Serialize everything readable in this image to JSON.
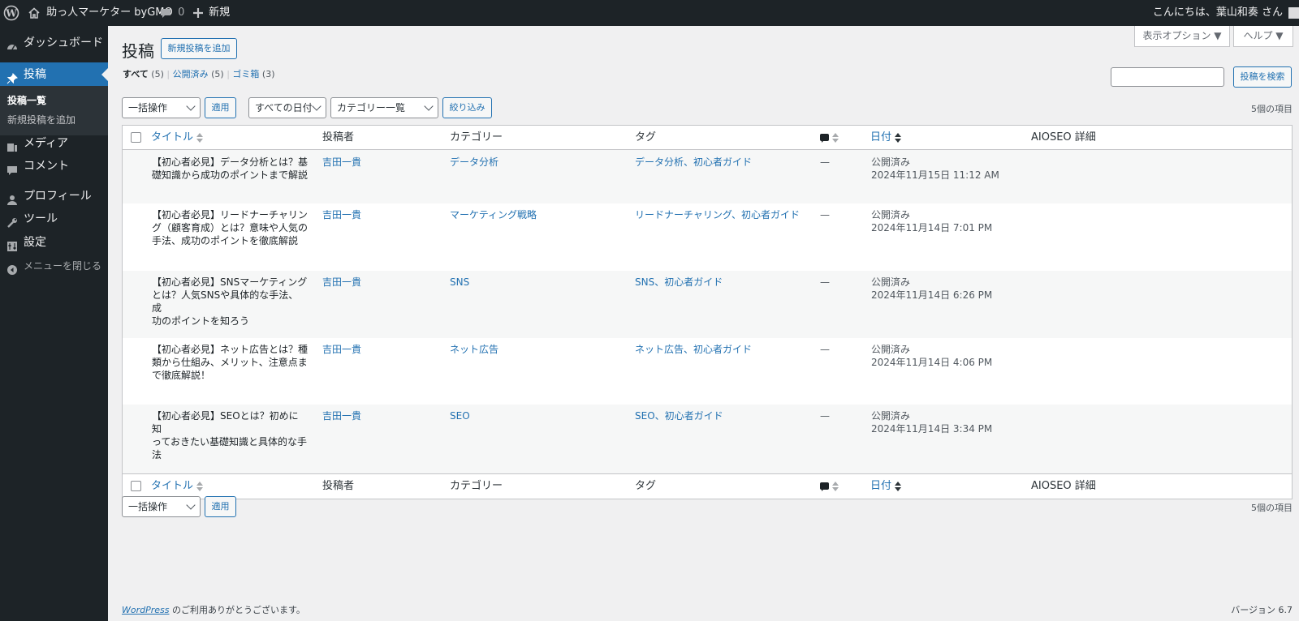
{
  "topbar": {
    "site_name": "助っ人マーケター byGMO",
    "comments_count": "0",
    "new_label": "新規",
    "greeting": "こんにちは、葉山和奏 さん"
  },
  "sidebar": {
    "items": [
      {
        "label": "ダッシュボード",
        "icon": "dashboard-icon"
      },
      {
        "label": "投稿",
        "icon": "pin-icon"
      },
      {
        "label": "メディア",
        "icon": "media-icon"
      },
      {
        "label": "コメント",
        "icon": "comment-icon"
      },
      {
        "label": "プロフィール",
        "icon": "user-icon"
      },
      {
        "label": "ツール",
        "icon": "wrench-icon"
      },
      {
        "label": "設定",
        "icon": "settings-icon"
      },
      {
        "label": "メニューを閉じる",
        "icon": "collapse-icon"
      }
    ],
    "submenu": [
      {
        "label": "投稿一覧"
      },
      {
        "label": "新規投稿を追加"
      }
    ]
  },
  "page": {
    "title": "投稿",
    "add_new": "新規投稿を追加",
    "screen_options": "表示オプション ▼",
    "help": "ヘルプ ▼",
    "filters": {
      "all": "すべて",
      "all_count": "(5)",
      "published": "公開済み",
      "published_count": "(5)",
      "trash": "ゴミ箱",
      "trash_count": "(3)"
    },
    "search_placeholder": "",
    "search_button": "投稿を検索",
    "bulk_action": "一括操作",
    "apply": "適用",
    "date_filter": "すべての日付",
    "category_filter": "カテゴリー一覧",
    "filter_button": "絞り込み",
    "items_count": "5個の項目"
  },
  "table": {
    "columns": {
      "title": "タイトル",
      "author": "投稿者",
      "category": "カテゴリー",
      "tags": "タグ",
      "date": "日付",
      "aioseo": "AIOSEO 詳細"
    },
    "rows": [
      {
        "title_lines": [
          "【初心者必見】データ分析とは？基",
          "礎知識から成功のポイントまで解説"
        ],
        "author": "吉田一貴",
        "category": "データ分析",
        "tags": "データ分析、初心者ガイド",
        "comments": "—",
        "status": "公開済み",
        "date": "2024年11月15日 11:12 AM"
      },
      {
        "title_lines": [
          "【初心者必見】リードナーチャリン",
          "グ（顧客育成）とは？意味や人気の",
          "手法、成功のポイントを徹底解説"
        ],
        "author": "吉田一貴",
        "category": "マーケティング戦略",
        "tags": "リードナーチャリング、初心者ガイド",
        "comments": "—",
        "status": "公開済み",
        "date": "2024年11月14日 7:01 PM"
      },
      {
        "title_lines": [
          "【初心者必見】SNSマーケティング",
          "とは？人気SNSや具体的な手法、成",
          "功のポイントを知ろう"
        ],
        "author": "吉田一貴",
        "category": "SNS",
        "tags": "SNS、初心者ガイド",
        "comments": "—",
        "status": "公開済み",
        "date": "2024年11月14日 6:26 PM"
      },
      {
        "title_lines": [
          "【初心者必見】ネット広告とは？種",
          "類から仕組み、メリット、注意点ま",
          "で徹底解説！"
        ],
        "author": "吉田一貴",
        "category": "ネット広告",
        "tags": "ネット広告、初心者ガイド",
        "comments": "—",
        "status": "公開済み",
        "date": "2024年11月14日 4:06 PM"
      },
      {
        "title_lines": [
          "【初心者必見】SEOとは？初めに知",
          "っておきたい基礎知識と具体的な手",
          "法"
        ],
        "author": "吉田一貴",
        "category": "SEO",
        "tags": "SEO、初心者ガイド",
        "comments": "—",
        "status": "公開済み",
        "date": "2024年11月14日 3:34 PM"
      }
    ]
  },
  "footer": {
    "wordpress_link": "WordPress",
    "thanks": " のご利用ありがとうございます。",
    "version": "バージョン 6.7"
  }
}
